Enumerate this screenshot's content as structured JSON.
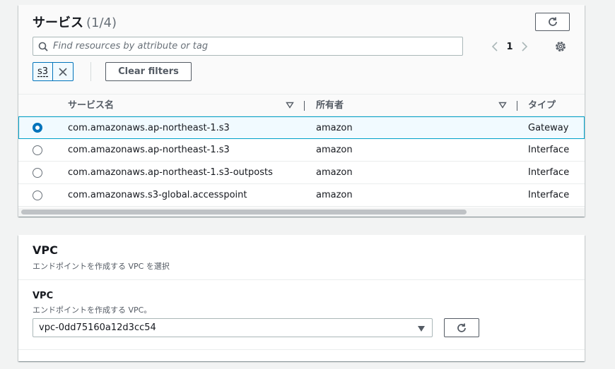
{
  "services": {
    "title": "サービス",
    "count": "(1/4)",
    "search_placeholder": "Find resources by attribute or tag",
    "current_page": "1",
    "filter_token": "s3",
    "clear_filters_label": "Clear filters",
    "columns": {
      "service_name": "サービス名",
      "owner": "所有者",
      "type": "タイプ"
    },
    "rows": [
      {
        "service_name": "com.amazonaws.ap-northeast-1.s3",
        "owner": "amazon",
        "type": "Gateway",
        "selected": true
      },
      {
        "service_name": "com.amazonaws.ap-northeast-1.s3",
        "owner": "amazon",
        "type": "Interface",
        "selected": false
      },
      {
        "service_name": "com.amazonaws.ap-northeast-1.s3-outposts",
        "owner": "amazon",
        "type": "Interface",
        "selected": false
      },
      {
        "service_name": "com.amazonaws.s3-global.accesspoint",
        "owner": "amazon",
        "type": "Interface",
        "selected": false
      }
    ]
  },
  "vpc": {
    "title": "VPC",
    "description": "エンドポイントを作成する VPC を選択",
    "field_label": "VPC",
    "field_description": "エンドポイントを作成する VPC。",
    "selected_value": "vpc-0dd75160a12d3cc54"
  },
  "colors": {
    "accent": "#0073bb",
    "selected_row_border": "#00a1c9",
    "selected_row_bg": "#f1faff"
  },
  "icons": [
    "refresh-icon",
    "search-icon",
    "chevron-left-icon",
    "chevron-right-icon",
    "gear-icon",
    "close-icon",
    "sort-down-icon",
    "caret-down-icon"
  ]
}
